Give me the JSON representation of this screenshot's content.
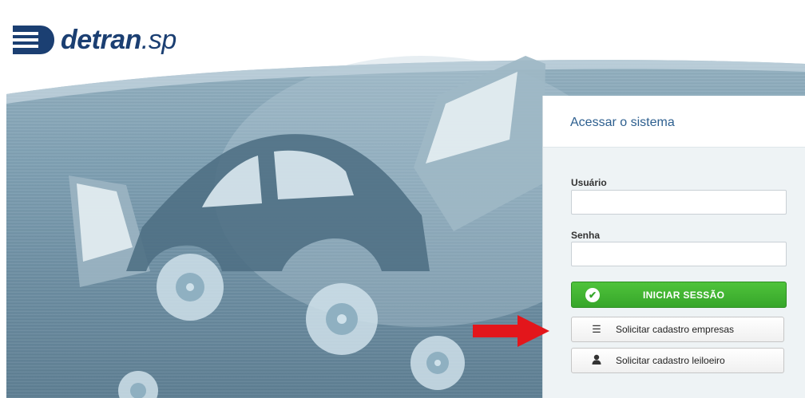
{
  "brand": {
    "logo_text_main": "detran",
    "logo_text_suffix": ".sp"
  },
  "login": {
    "title": "Acessar o sistema",
    "username_label": "Usuário",
    "username_value": "",
    "password_label": "Senha",
    "password_value": "",
    "submit_label": "INICIAR SESSÃO",
    "request_company_label": "Solicitar cadastro empresas",
    "request_auctioneer_label": "Solicitar cadastro leiloeiro"
  },
  "colors": {
    "brand_blue": "#1b3f72",
    "title_blue": "#2d5f8f",
    "primary_green": "#36a62a",
    "arrow_red": "#e3161b"
  },
  "icons": {
    "submit": "check-circle-icon",
    "company": "list-icon",
    "auctioneer": "user-icon",
    "annotation": "red-arrow-icon"
  }
}
